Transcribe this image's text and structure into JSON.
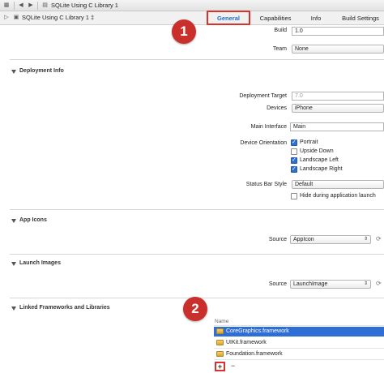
{
  "toolbar": {
    "project_name": "SQLite Using C Library 1",
    "target_name": "SQLite Using C Library 1 ‡"
  },
  "tabs": [
    "General",
    "Capabilities",
    "Info",
    "Build Settings"
  ],
  "callouts": [
    "1",
    "2"
  ],
  "identity": {
    "build_label": "Build",
    "build_value": "1.0",
    "team_label": "Team",
    "team_value": "None"
  },
  "deployment": {
    "section_title": "Deployment Info",
    "target_label": "Deployment Target",
    "target_value": "7.0",
    "devices_label": "Devices",
    "devices_value": "iPhone",
    "main_interface_label": "Main Interface",
    "main_interface_value": "Main",
    "orientation_label": "Device Orientation",
    "orientations": [
      {
        "label": "Portrait",
        "checked": true
      },
      {
        "label": "Upside Down",
        "checked": false
      },
      {
        "label": "Landscape Left",
        "checked": true
      },
      {
        "label": "Landscape Right",
        "checked": true
      }
    ],
    "status_bar_label": "Status Bar Style",
    "status_bar_value": "Default",
    "hide_label": "Hide during application launch"
  },
  "app_icons": {
    "section_title": "App Icons",
    "source_label": "Source",
    "source_value": "AppIcon"
  },
  "launch_images": {
    "section_title": "Launch Images",
    "source_label": "Source",
    "source_value": "LaunchImage"
  },
  "frameworks": {
    "section_title": "Linked Frameworks and Libraries",
    "column_name": "Name",
    "items": [
      "CoreGraphics.framework",
      "UIKit.framework",
      "Foundation.framework"
    ],
    "add_label": "+",
    "remove_label": "−"
  },
  "colors": {
    "highlight": "#d8322a",
    "callout": "#c9302c",
    "selection": "#2f6fd5",
    "tab_selected": "#1c6fd1"
  }
}
